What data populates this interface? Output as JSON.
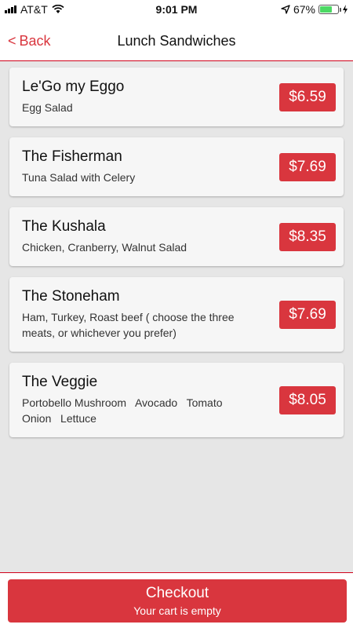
{
  "status_bar": {
    "carrier": "AT&T",
    "time": "9:01 PM",
    "battery": "67%",
    "battery_level": 0.67,
    "icons": [
      "signal-icon",
      "wifi-icon",
      "location-arrow-icon",
      "battery-icon",
      "charging-bolt-icon"
    ]
  },
  "nav": {
    "back_label": "Back",
    "back_glyph": "<",
    "title": "Lunch Sandwiches"
  },
  "items": [
    {
      "name": "Le'Go my Eggo",
      "description": "Egg Salad",
      "price": "$6.59"
    },
    {
      "name": "The Fisherman",
      "description": "Tuna Salad with Celery",
      "price": "$7.69"
    },
    {
      "name": "The Kushala",
      "description": "Chicken, Cranberry, Walnut Salad",
      "price": "$8.35"
    },
    {
      "name": "The Stoneham",
      "description": "Ham, Turkey, Roast beef ( choose the three meats, or whichever you prefer)",
      "price": "$7.69"
    },
    {
      "name": "The Veggie",
      "description": "Portobello Mushroom   Avocado   Tomato   Onion   Lettuce",
      "price": "$8.05"
    }
  ],
  "checkout": {
    "label": "Checkout",
    "subtitle": "Your cart is empty"
  },
  "colors": {
    "accent": "#d9363e",
    "background": "#e6e6e6",
    "card": "#f6f6f6"
  }
}
